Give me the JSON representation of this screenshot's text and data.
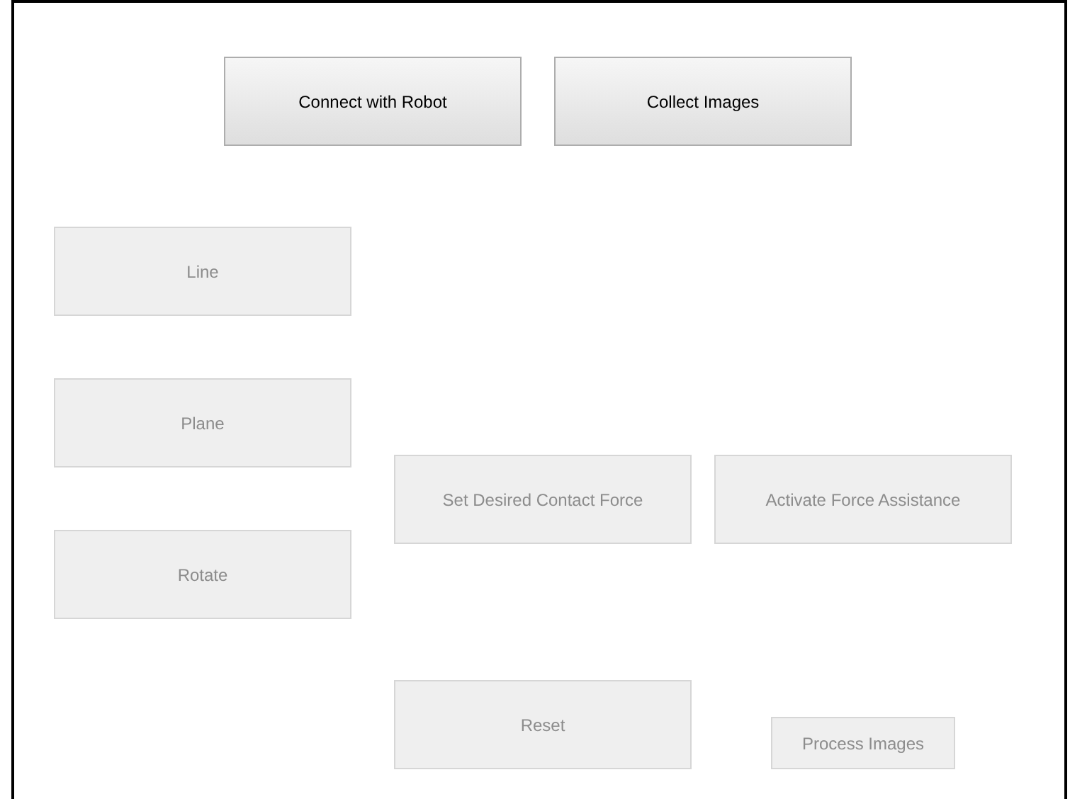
{
  "top_buttons": [
    {
      "label": "Connect with Robot",
      "disabled": false
    },
    {
      "label": "Collect Images",
      "disabled": false
    }
  ],
  "mode_buttons": [
    {
      "label": "Line",
      "disabled": true
    },
    {
      "label": "Plane",
      "disabled": true
    },
    {
      "label": "Rotate",
      "disabled": true
    }
  ],
  "force_buttons": [
    {
      "label": "Set Desired Contact Force",
      "disabled": true
    },
    {
      "label": "Activate Force Assistance",
      "disabled": true
    }
  ],
  "reset_button": {
    "label": "Reset",
    "disabled": true
  },
  "process_button": {
    "label": "Process Images",
    "disabled": true
  }
}
